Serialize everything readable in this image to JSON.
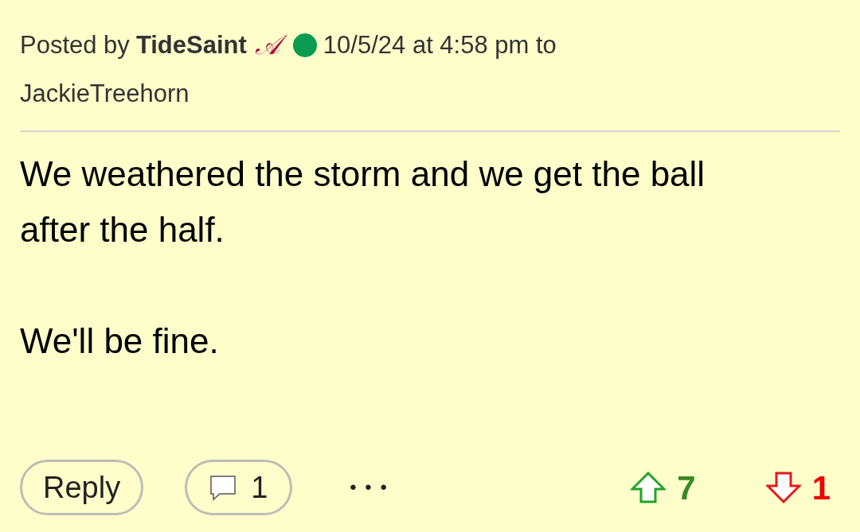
{
  "post": {
    "posted_by_label": "Posted by",
    "author": "TideSaint",
    "team_badge": "𝒜",
    "online": true,
    "timestamp": "10/5/24 at 4:58 pm to",
    "recipient": "JackieTreehorn",
    "body": [
      "We weathered the storm and we get the ball after the half.",
      "We'll be fine."
    ],
    "actions": {
      "reply": "Reply",
      "comments": "1",
      "more": "• • •",
      "upvotes": "7",
      "downvotes": "1"
    }
  }
}
